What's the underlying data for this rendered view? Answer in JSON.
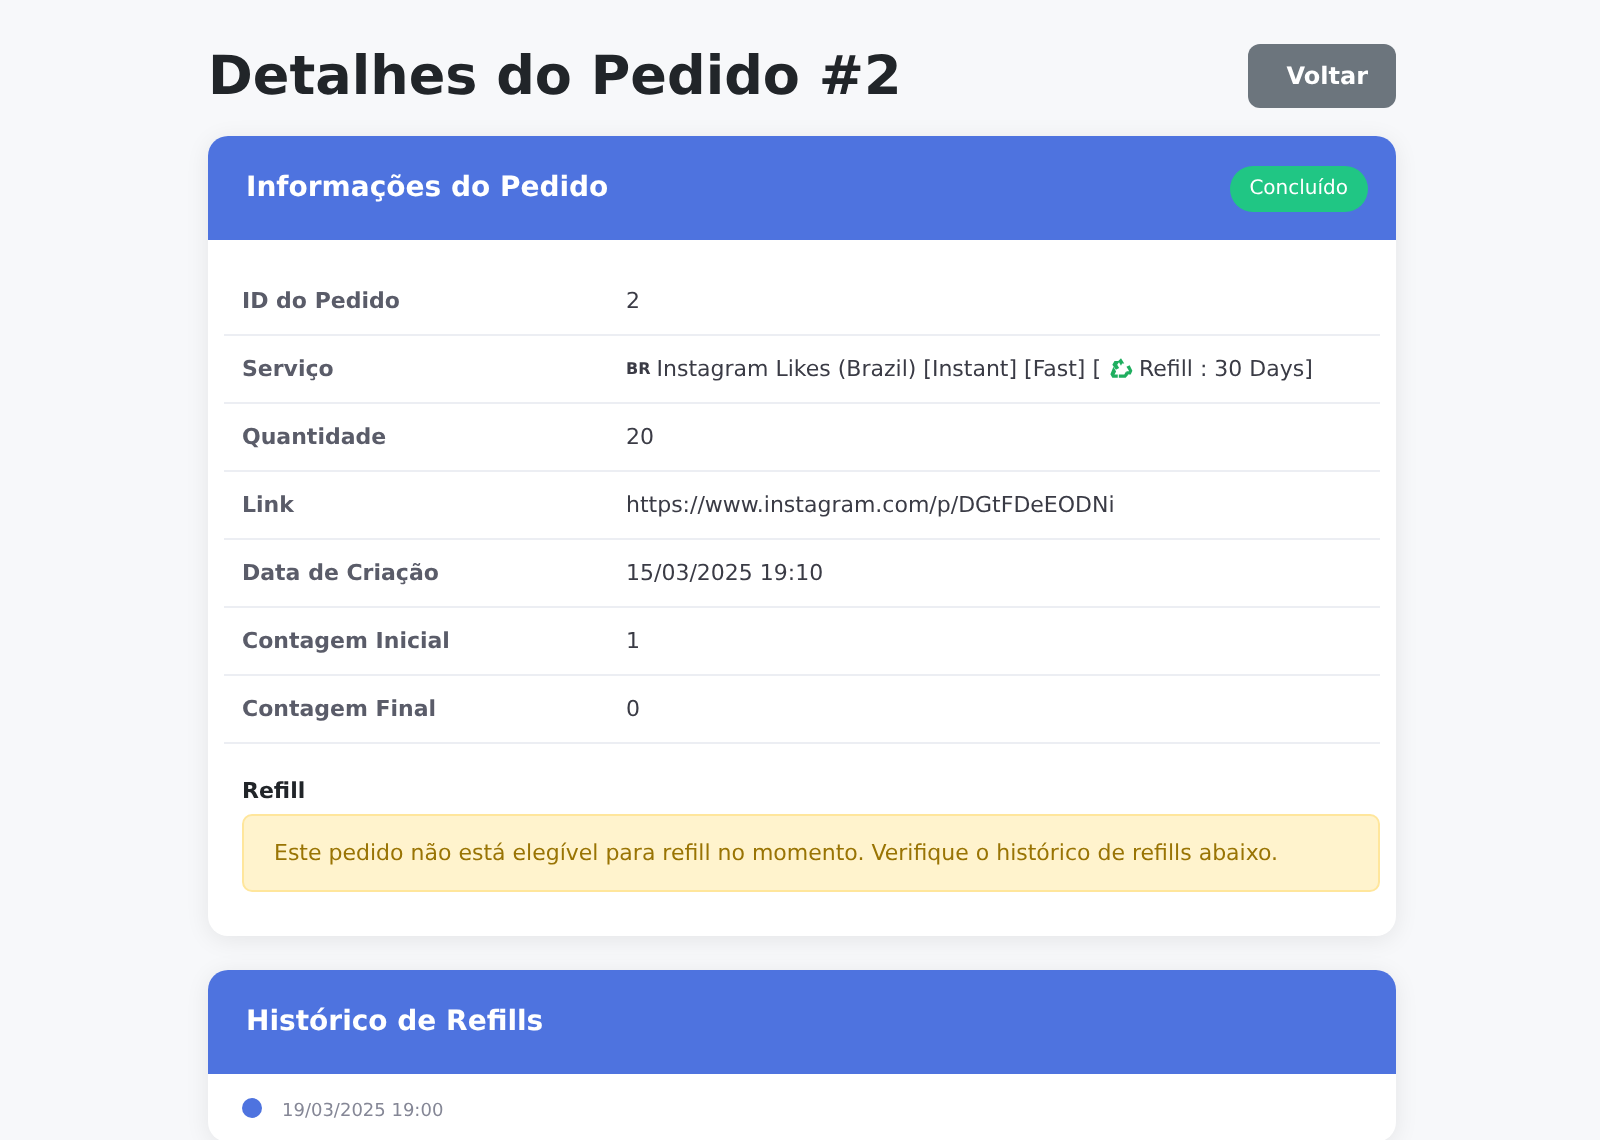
{
  "page_title": "Detalhes do Pedido #2",
  "back_button": "Voltar",
  "order_card": {
    "title": "Informações do Pedido",
    "status": {
      "label": "Concluído",
      "color": "#20c684"
    },
    "rows": [
      {
        "kind": "text",
        "label": "ID do Pedido",
        "value": "2"
      },
      {
        "kind": "service",
        "label": "Serviço",
        "flag": "BR",
        "value": "Instagram Likes (Brazil) [Instant] [Fast] [",
        "suffix": "Refill : 30 Days]"
      },
      {
        "kind": "text",
        "label": "Quantidade",
        "value": "20"
      },
      {
        "kind": "text",
        "label": "Link",
        "value": "https://www.instagram.com/p/DGtFDeEODNi"
      },
      {
        "kind": "text",
        "label": "Data de Criação",
        "value": "15/03/2025 19:10"
      },
      {
        "kind": "text",
        "label": "Contagem Inicial",
        "value": "1"
      },
      {
        "kind": "text",
        "label": "Contagem Final",
        "value": "0"
      }
    ],
    "refill": {
      "heading": "Refill",
      "notice": "Este pedido não está elegível para refill no momento. Verifique o histórico de refills abaixo."
    }
  },
  "history_card": {
    "title": "Histórico de Refills",
    "entries": [
      {
        "date": "19/03/2025 19:00",
        "color": "#4e73df"
      }
    ]
  }
}
